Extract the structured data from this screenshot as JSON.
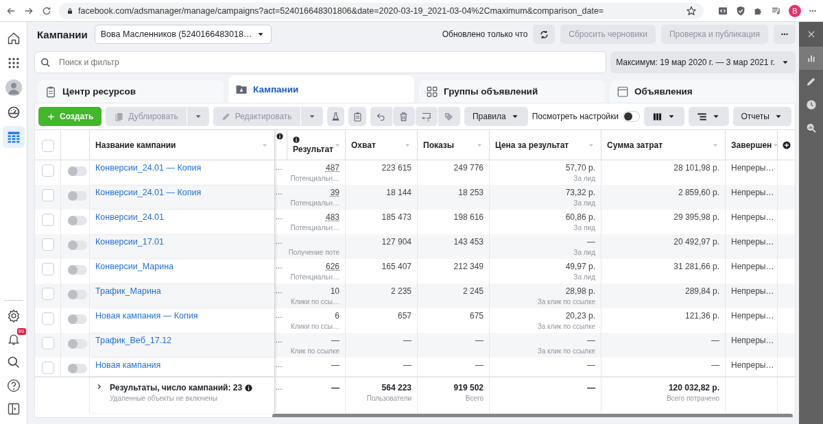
{
  "browser": {
    "url": "facebook.com/adsmanager/manage/campaigns?act=524016648301806&date=2020-03-19_2021-03-04%2Cmaximum&comparison_date=",
    "profile": "В"
  },
  "left_nav": {
    "top": [
      {
        "selected": false
      },
      {
        "selected": false
      },
      {
        "selected": false
      },
      {
        "selected": false
      },
      {
        "selected": true
      }
    ],
    "notification_count": "99"
  },
  "header": {
    "title": "Кампании",
    "account": "Вова Масленников (5240166483018…",
    "status": "Обновлено только что",
    "buttons": [
      {
        "label": "Сбросить черновики",
        "disabled": true
      },
      {
        "label": "Проверка и публикация",
        "disabled": true
      }
    ]
  },
  "search": {
    "placeholder": "Поиск и фильтр"
  },
  "date_range": "Максимум: 19 мар 2020 г. — 3 мар 2021 г.",
  "tabs": [
    {
      "label": "Центр ресурсов",
      "selected": false
    },
    {
      "label": "Кампании",
      "selected": true
    },
    {
      "label": "Группы объявлений",
      "selected": false
    },
    {
      "label": "Объявления",
      "selected": false
    }
  ],
  "toolbar": {
    "create": "Создать",
    "duplicate": {
      "label": "Дублировать",
      "disabled": true
    },
    "edit": {
      "label": "Редактировать",
      "disabled": true
    },
    "rules": "Правила",
    "view_settings": {
      "label": "Посмотреть настройки",
      "on": false
    },
    "reports": "Отчеты"
  },
  "table": {
    "select_all": {
      "checked": false
    },
    "columns": [
      {
        "label": "Название кампании"
      },
      {
        "label": "Результат",
        "info": true
      },
      {
        "label": "Охват"
      },
      {
        "label": "Показы"
      },
      {
        "label": "Цена за результат"
      },
      {
        "label": "Сумма затрат"
      },
      {
        "label": "Завершен"
      }
    ],
    "rows": [
      {
        "checked": false,
        "on": false,
        "name": "Конверсии_24.01 — Копия",
        "column_4": "…",
        "results": "487",
        "results_type": "Потенциальн…",
        "reach": "223 615",
        "impressions": "249 776",
        "cost": "57,70 р.",
        "cost_type": "За лид",
        "spent": "28 101,98 р.",
        "end": "Непреры…"
      },
      {
        "checked": false,
        "on": false,
        "name": "Конверсии_24.01 — Копия",
        "column_4": "…",
        "results": "39",
        "results_type": "Потенциальн…",
        "reach": "18 144",
        "impressions": "18 253",
        "cost": "73,32 р.",
        "cost_type": "За лид",
        "spent": "2 859,60 р.",
        "end": "Непреры…"
      },
      {
        "checked": false,
        "on": false,
        "name": "Конверсии_24.01",
        "column_4": "…",
        "results": "483",
        "results_type": "Потенциальн…",
        "reach": "185 473",
        "impressions": "198 616",
        "cost": "60,86 р.",
        "cost_type": "За лид",
        "spent": "29 395,98 р.",
        "end": "Непреры…"
      },
      {
        "checked": false,
        "on": false,
        "name": "Конверсии_17.01",
        "column_4": "…",
        "results_type": "Получение поте",
        "reach": "127 904",
        "impressions": "143 453",
        "cost": "—",
        "cost_type": "За лид",
        "spent": "20 492,97 р.",
        "end": "Непреры…"
      },
      {
        "checked": false,
        "on": false,
        "name": "Конверсии_Марина",
        "column_4": "…",
        "results": "626",
        "results_type": "Потенциальн…",
        "reach": "165 407",
        "impressions": "212 349",
        "cost": "49,97 р.",
        "cost_type": "За лид",
        "spent": "31 281,66 р.",
        "end": "Непреры…"
      },
      {
        "checked": false,
        "on": false,
        "name": "Трафик_Марина",
        "column_4": "…",
        "results": "10",
        "results_type": "Клики по ссы…",
        "reach": "2 235",
        "impressions": "2 245",
        "cost": "28,98 р.",
        "cost_type": "За клик по ссылке",
        "spent": "289,84 р.",
        "end": "Непреры…"
      },
      {
        "checked": false,
        "on": false,
        "name": "Новая кампания — Копия",
        "column_4": "…",
        "results": "6",
        "results_type": "Клики по ссы…",
        "reach": "657",
        "impressions": "675",
        "cost": "20,23 р.",
        "cost_type": "За клик по ссылке",
        "spent": "121,36 р.",
        "end": "Непреры…"
      },
      {
        "checked": false,
        "on": false,
        "name": "Трафик_Веб_17.12",
        "column_4": "…",
        "results": "—",
        "results_type": "Клик по ссылке",
        "reach": "—",
        "impressions": "—",
        "cost": "—",
        "cost_type": "За клик по ссылке",
        "spent": "—",
        "end": "Непреры…"
      },
      {
        "checked": false,
        "on": false,
        "name": "Новая кампания",
        "column_4": "…",
        "results": "—",
        "reach": "—",
        "impressions": "—",
        "cost": "—",
        "spent": "—",
        "end": "Непреры…"
      }
    ],
    "summary": {
      "title": "Результаты, число кампаний: 23",
      "note": "Удаленные объекты не включены",
      "column_4": "…",
      "results": "—",
      "reach": "564 223",
      "reach_note": "Пользователи",
      "impressions": "919 502",
      "impressions_note": "Всего",
      "cost": "—",
      "spent": "120 032,82 р.",
      "spent_note": "Всего потрачено"
    }
  },
  "right_panel": {
    "items": [
      {
        "selected": true
      },
      {
        "selected": false
      },
      {
        "selected": false
      },
      {
        "selected": false
      }
    ]
  }
}
